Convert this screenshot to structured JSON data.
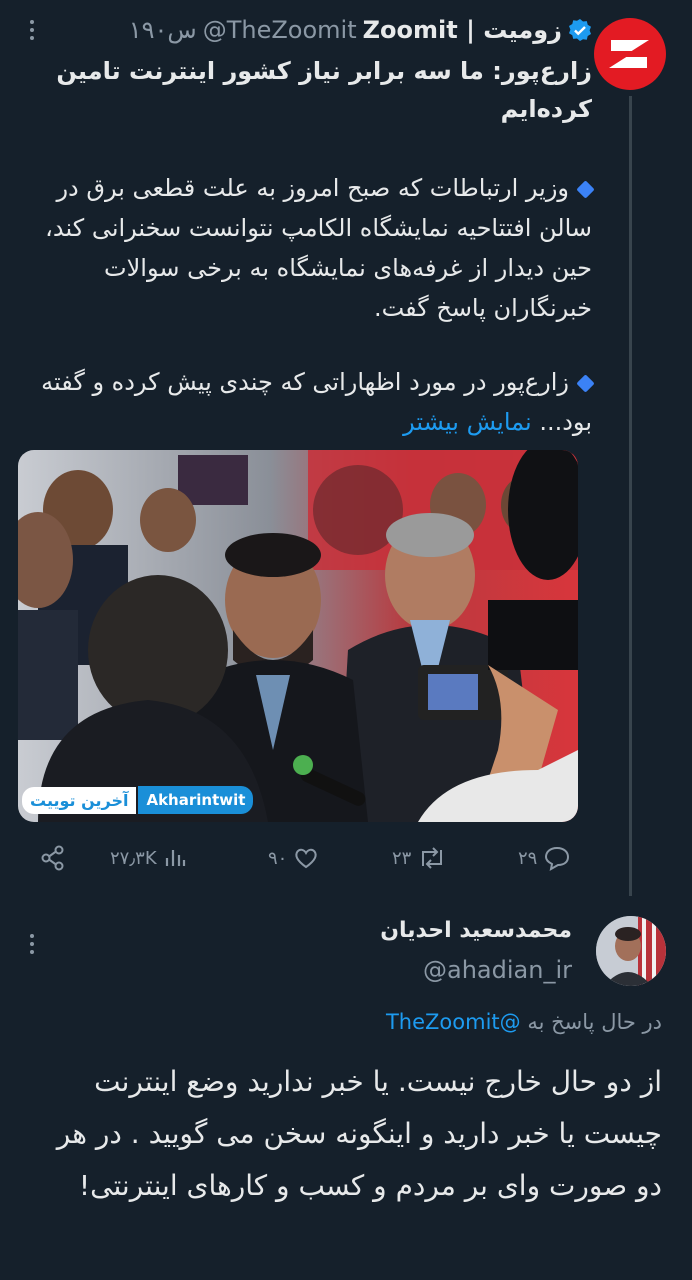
{
  "tweet": {
    "display_name": "زومیت | Zoomit",
    "handle": "@TheZoomit",
    "time": "۱۹۰س",
    "title": "زارع‌پور: ما سه برابر نیاز کشور اینترنت تامین کرده‌ایم",
    "paragraph1": "وزیر ارتباطات که صبح امروز به علت قطعی برق در سالن افتتاحیه نمایشگاه الکامپ نتوانست سخنرانی کند، حین دیدار از غرفه‌های نمایشگاه به برخی سوالات خبرنگاران پاسخ گفت.",
    "paragraph2": "زارع‌پور در مورد اظهاراتی که چندی پیش کرده و گفته بود... ",
    "show_more": "نمایش بیشتر",
    "media_watermark_fa": "آخرین توییت",
    "media_watermark_en": "Akharintwit",
    "stats": {
      "views": "۲۷٫۳K",
      "likes": "۹۰",
      "retweets": "۲۳",
      "replies": "۲۹"
    }
  },
  "reply": {
    "display_name": "محمدسعید احدیان",
    "handle": "@ahadian_ir",
    "replying_prefix": "در حال پاسخ به",
    "replying_to": "@TheZoomit",
    "body": "از دو حال خارج نیست. یا خبر ندارید وضع اینترنت چیست یا خبر دارید و اینگونه سخن می گویید . در هر دو صورت وای بر مردم و کسب و کارهای اینترنتی!"
  },
  "icons": [
    "zoomit-logo-icon",
    "verified-badge-icon",
    "more-icon",
    "share-icon",
    "views-icon",
    "like-icon",
    "retweet-icon",
    "reply-icon"
  ],
  "colors": {
    "background": "#15202b",
    "accent": "#1d9bf0",
    "brand_red": "#e31b23",
    "muted": "#8b98a5"
  }
}
